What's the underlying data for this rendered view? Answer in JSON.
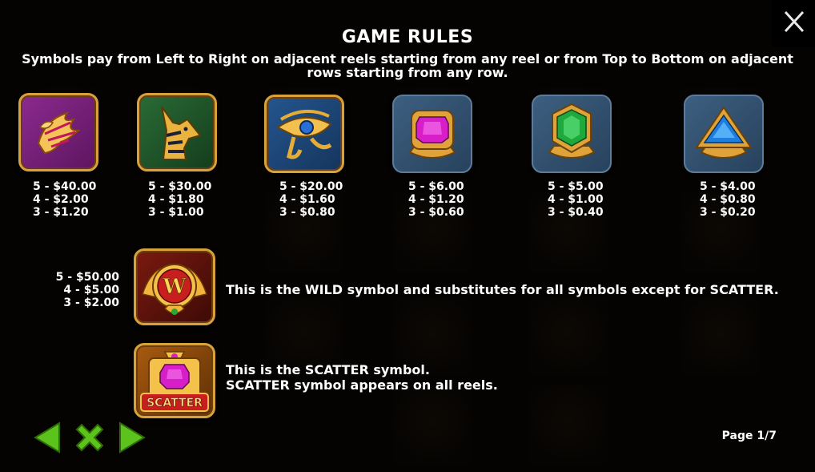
{
  "title": "GAME RULES",
  "subtitle": "Symbols pay from Left to Right on adjacent reels starting from any reel or from Top to Bottom on adjacent rows starting from any row.",
  "symbols": [
    {
      "icon": "bird-icon",
      "pays": [
        "5 - $40.00",
        "4 - $2.00",
        "3 - $1.20"
      ]
    },
    {
      "icon": "anubis-icon",
      "pays": [
        "5 - $30.00",
        "4 - $1.80",
        "3 - $1.00"
      ]
    },
    {
      "icon": "eye-of-horus-icon",
      "pays": [
        "5 - $20.00",
        "4 - $1.60",
        "3 - $0.80"
      ]
    },
    {
      "icon": "pink-gem-icon",
      "pays": [
        "5 - $6.00",
        "4 - $1.20",
        "3 - $0.60"
      ]
    },
    {
      "icon": "green-gem-icon",
      "pays": [
        "5 - $5.00",
        "4 - $1.00",
        "3 - $0.40"
      ]
    },
    {
      "icon": "blue-gem-icon",
      "pays": [
        "5 - $4.00",
        "4 - $0.80",
        "3 - $0.20"
      ]
    }
  ],
  "wild": {
    "icon": "wild-icon",
    "letter": "W",
    "pays": [
      "5 - $50.00",
      "4 - $5.00",
      "3 - $2.00"
    ],
    "description": "This is the WILD symbol and substitutes for all symbols except for SCATTER."
  },
  "scatter": {
    "icon": "scatter-icon",
    "label": "SCATTER",
    "description_line1": "This is the SCATTER symbol.",
    "description_line2": "SCATTER symbol appears on all reels."
  },
  "page_indicator": "Page 1/7",
  "colors": {
    "nav_green": "#5cc21c",
    "gold": "#d8a23a",
    "purple_tile": "#7a1f7e",
    "green_tile": "#1f5a2c",
    "blue_tile": "#1f4d8a",
    "stone_tile": "#355572"
  }
}
